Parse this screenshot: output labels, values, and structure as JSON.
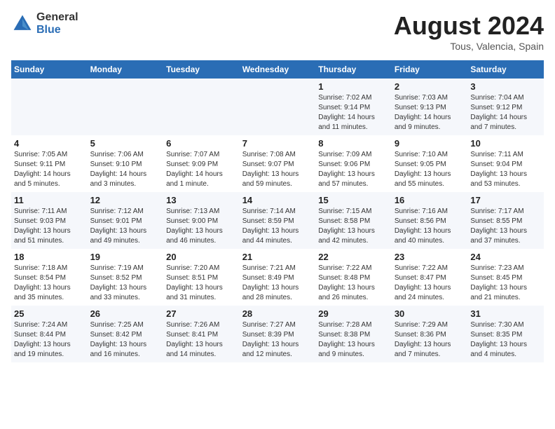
{
  "header": {
    "logo_general": "General",
    "logo_blue": "Blue",
    "title": "August 2024",
    "location": "Tous, Valencia, Spain"
  },
  "days_of_week": [
    "Sunday",
    "Monday",
    "Tuesday",
    "Wednesday",
    "Thursday",
    "Friday",
    "Saturday"
  ],
  "weeks": [
    [
      {
        "day": "",
        "detail": ""
      },
      {
        "day": "",
        "detail": ""
      },
      {
        "day": "",
        "detail": ""
      },
      {
        "day": "",
        "detail": ""
      },
      {
        "day": "1",
        "detail": "Sunrise: 7:02 AM\nSunset: 9:14 PM\nDaylight: 14 hours\nand 11 minutes."
      },
      {
        "day": "2",
        "detail": "Sunrise: 7:03 AM\nSunset: 9:13 PM\nDaylight: 14 hours\nand 9 minutes."
      },
      {
        "day": "3",
        "detail": "Sunrise: 7:04 AM\nSunset: 9:12 PM\nDaylight: 14 hours\nand 7 minutes."
      }
    ],
    [
      {
        "day": "4",
        "detail": "Sunrise: 7:05 AM\nSunset: 9:11 PM\nDaylight: 14 hours\nand 5 minutes."
      },
      {
        "day": "5",
        "detail": "Sunrise: 7:06 AM\nSunset: 9:10 PM\nDaylight: 14 hours\nand 3 minutes."
      },
      {
        "day": "6",
        "detail": "Sunrise: 7:07 AM\nSunset: 9:09 PM\nDaylight: 14 hours\nand 1 minute."
      },
      {
        "day": "7",
        "detail": "Sunrise: 7:08 AM\nSunset: 9:07 PM\nDaylight: 13 hours\nand 59 minutes."
      },
      {
        "day": "8",
        "detail": "Sunrise: 7:09 AM\nSunset: 9:06 PM\nDaylight: 13 hours\nand 57 minutes."
      },
      {
        "day": "9",
        "detail": "Sunrise: 7:10 AM\nSunset: 9:05 PM\nDaylight: 13 hours\nand 55 minutes."
      },
      {
        "day": "10",
        "detail": "Sunrise: 7:11 AM\nSunset: 9:04 PM\nDaylight: 13 hours\nand 53 minutes."
      }
    ],
    [
      {
        "day": "11",
        "detail": "Sunrise: 7:11 AM\nSunset: 9:03 PM\nDaylight: 13 hours\nand 51 minutes."
      },
      {
        "day": "12",
        "detail": "Sunrise: 7:12 AM\nSunset: 9:01 PM\nDaylight: 13 hours\nand 49 minutes."
      },
      {
        "day": "13",
        "detail": "Sunrise: 7:13 AM\nSunset: 9:00 PM\nDaylight: 13 hours\nand 46 minutes."
      },
      {
        "day": "14",
        "detail": "Sunrise: 7:14 AM\nSunset: 8:59 PM\nDaylight: 13 hours\nand 44 minutes."
      },
      {
        "day": "15",
        "detail": "Sunrise: 7:15 AM\nSunset: 8:58 PM\nDaylight: 13 hours\nand 42 minutes."
      },
      {
        "day": "16",
        "detail": "Sunrise: 7:16 AM\nSunset: 8:56 PM\nDaylight: 13 hours\nand 40 minutes."
      },
      {
        "day": "17",
        "detail": "Sunrise: 7:17 AM\nSunset: 8:55 PM\nDaylight: 13 hours\nand 37 minutes."
      }
    ],
    [
      {
        "day": "18",
        "detail": "Sunrise: 7:18 AM\nSunset: 8:54 PM\nDaylight: 13 hours\nand 35 minutes."
      },
      {
        "day": "19",
        "detail": "Sunrise: 7:19 AM\nSunset: 8:52 PM\nDaylight: 13 hours\nand 33 minutes."
      },
      {
        "day": "20",
        "detail": "Sunrise: 7:20 AM\nSunset: 8:51 PM\nDaylight: 13 hours\nand 31 minutes."
      },
      {
        "day": "21",
        "detail": "Sunrise: 7:21 AM\nSunset: 8:49 PM\nDaylight: 13 hours\nand 28 minutes."
      },
      {
        "day": "22",
        "detail": "Sunrise: 7:22 AM\nSunset: 8:48 PM\nDaylight: 13 hours\nand 26 minutes."
      },
      {
        "day": "23",
        "detail": "Sunrise: 7:22 AM\nSunset: 8:47 PM\nDaylight: 13 hours\nand 24 minutes."
      },
      {
        "day": "24",
        "detail": "Sunrise: 7:23 AM\nSunset: 8:45 PM\nDaylight: 13 hours\nand 21 minutes."
      }
    ],
    [
      {
        "day": "25",
        "detail": "Sunrise: 7:24 AM\nSunset: 8:44 PM\nDaylight: 13 hours\nand 19 minutes."
      },
      {
        "day": "26",
        "detail": "Sunrise: 7:25 AM\nSunset: 8:42 PM\nDaylight: 13 hours\nand 16 minutes."
      },
      {
        "day": "27",
        "detail": "Sunrise: 7:26 AM\nSunset: 8:41 PM\nDaylight: 13 hours\nand 14 minutes."
      },
      {
        "day": "28",
        "detail": "Sunrise: 7:27 AM\nSunset: 8:39 PM\nDaylight: 13 hours\nand 12 minutes."
      },
      {
        "day": "29",
        "detail": "Sunrise: 7:28 AM\nSunset: 8:38 PM\nDaylight: 13 hours\nand 9 minutes."
      },
      {
        "day": "30",
        "detail": "Sunrise: 7:29 AM\nSunset: 8:36 PM\nDaylight: 13 hours\nand 7 minutes."
      },
      {
        "day": "31",
        "detail": "Sunrise: 7:30 AM\nSunset: 8:35 PM\nDaylight: 13 hours\nand 4 minutes."
      }
    ]
  ]
}
